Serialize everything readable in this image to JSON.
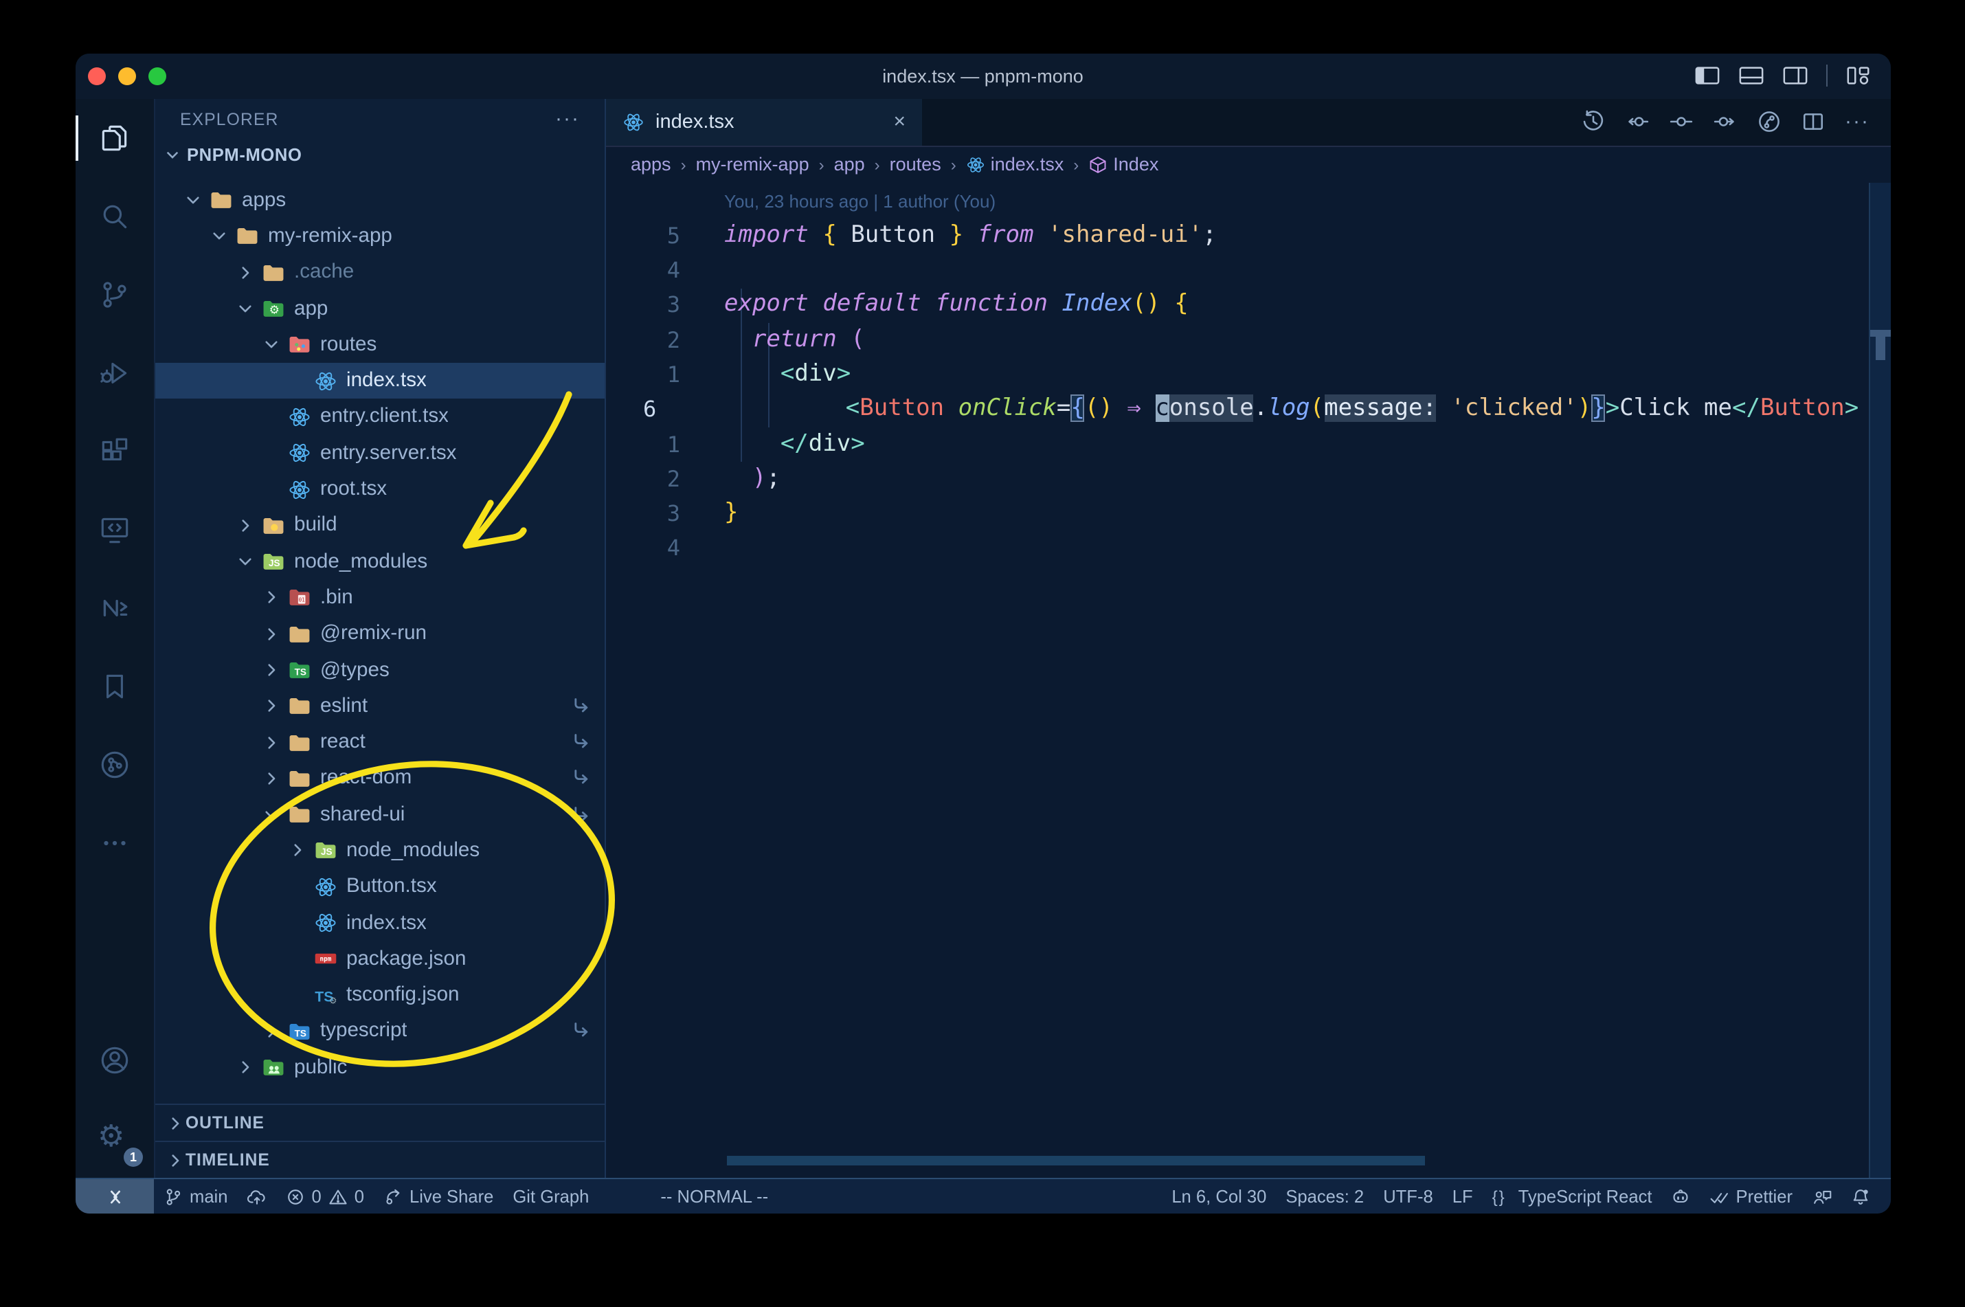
{
  "window": {
    "title": "index.tsx — pnpm-mono"
  },
  "titlebar": {
    "traffic_lights": [
      "close",
      "minimize",
      "zoom"
    ],
    "right_icons": [
      "layout-sidebar-left",
      "layout-panel",
      "layout-sidebar-right",
      "divider",
      "layout-customize"
    ]
  },
  "activity_bar": {
    "active": "files",
    "top": [
      "files",
      "search",
      "source-control",
      "run-debug",
      "extensions",
      "remote-explorer",
      "nx-console",
      "bookmarks",
      "git-graph-act",
      "more-act"
    ],
    "bottom": [
      "account",
      "settings"
    ],
    "settings_badge": "1"
  },
  "explorer": {
    "header": "EXPLORER",
    "header_more": "···",
    "root": "PNPM-MONO",
    "items": [
      {
        "label": "apps",
        "icon": "folder-tan",
        "level": 1,
        "chevron": "down"
      },
      {
        "label": "my-remix-app",
        "icon": "folder-tan",
        "level": 2,
        "chevron": "down"
      },
      {
        "label": ".cache",
        "icon": "folder-tan",
        "level": 3,
        "chevron": "right",
        "dim": true
      },
      {
        "label": "app",
        "icon": "folder-app",
        "level": 3,
        "chevron": "down"
      },
      {
        "label": "routes",
        "icon": "folder-routes",
        "level": 4,
        "chevron": "down"
      },
      {
        "label": "index.tsx",
        "icon": "react",
        "level": 5,
        "selected": true
      },
      {
        "label": "entry.client.tsx",
        "icon": "react",
        "level": 4
      },
      {
        "label": "entry.server.tsx",
        "icon": "react",
        "level": 4
      },
      {
        "label": "root.tsx",
        "icon": "react",
        "level": 4
      },
      {
        "label": "build",
        "icon": "folder-build",
        "level": 3,
        "chevron": "right"
      },
      {
        "label": "node_modules",
        "icon": "folder-js",
        "level": 3,
        "chevron": "down"
      },
      {
        "label": ".bin",
        "icon": "folder-bin",
        "level": 4,
        "chevron": "right"
      },
      {
        "label": "@remix-run",
        "icon": "folder-tan",
        "level": 4,
        "chevron": "right"
      },
      {
        "label": "@types",
        "icon": "folder-types",
        "level": 4,
        "chevron": "right"
      },
      {
        "label": "eslint",
        "icon": "folder-tan",
        "level": 4,
        "chevron": "right",
        "symlink": true
      },
      {
        "label": "react",
        "icon": "folder-tan",
        "level": 4,
        "chevron": "right",
        "symlink": true
      },
      {
        "label": "react-dom",
        "icon": "folder-tan",
        "level": 4,
        "chevron": "right",
        "symlink": true
      },
      {
        "label": "shared-ui",
        "icon": "folder-tan",
        "level": 4,
        "chevron": "down",
        "symlink": true
      },
      {
        "label": "node_modules",
        "icon": "folder-js",
        "level": 5,
        "chevron": "right"
      },
      {
        "label": "Button.tsx",
        "icon": "react",
        "level": 5
      },
      {
        "label": "index.tsx",
        "icon": "react",
        "level": 5
      },
      {
        "label": "package.json",
        "icon": "npm",
        "level": 5
      },
      {
        "label": "tsconfig.json",
        "icon": "ts-config",
        "level": 5
      },
      {
        "label": "typescript",
        "icon": "folder-ts",
        "level": 4,
        "chevron": "right",
        "symlink": true
      },
      {
        "label": "public",
        "icon": "folder-public",
        "level": 3,
        "chevron": "right"
      }
    ],
    "sections": [
      "OUTLINE",
      "TIMELINE"
    ]
  },
  "editor": {
    "tab": {
      "label": "index.tsx",
      "icon": "react",
      "close": "×"
    },
    "actions": [
      "history",
      "prev-change",
      "compare-change",
      "next-change",
      "git-graph-ed",
      "split-editor",
      "more-ed"
    ],
    "breadcrumbs": [
      {
        "label": "apps"
      },
      {
        "label": "my-remix-app"
      },
      {
        "label": "app"
      },
      {
        "label": "routes"
      },
      {
        "label": "index.tsx",
        "icon": "react"
      },
      {
        "label": "Index",
        "icon": "symbol-module"
      }
    ],
    "blame": "You, 23 hours ago | 1 author (You)",
    "code": {
      "lines": [
        {
          "gutter": "5",
          "indent": 0,
          "tokens": [
            {
              "t": "import",
              "c": "kw"
            },
            {
              "t": " ",
              "c": "pl"
            },
            {
              "t": "{",
              "c": "by"
            },
            {
              "t": " Button ",
              "c": "id"
            },
            {
              "t": "}",
              "c": "by"
            },
            {
              "t": " ",
              "c": "pl"
            },
            {
              "t": "from",
              "c": "kw"
            },
            {
              "t": " ",
              "c": "pl"
            },
            {
              "t": "'shared-ui'",
              "c": "str"
            },
            {
              "t": ";",
              "c": "pl"
            }
          ]
        },
        {
          "gutter": "4",
          "indent": 0,
          "tokens": []
        },
        {
          "gutter": "3",
          "indent": 0,
          "tokens": [
            {
              "t": "export",
              "c": "kw"
            },
            {
              "t": " ",
              "c": "pl"
            },
            {
              "t": "default",
              "c": "kw"
            },
            {
              "t": " ",
              "c": "pl"
            },
            {
              "t": "function",
              "c": "kw"
            },
            {
              "t": " ",
              "c": "pl"
            },
            {
              "t": "Index",
              "c": "fnname"
            },
            {
              "t": "()",
              "c": "by"
            },
            {
              "t": " ",
              "c": "pl"
            },
            {
              "t": "{",
              "c": "by"
            }
          ]
        },
        {
          "gutter": "2",
          "indent": 2,
          "tokens": [
            {
              "t": "return",
              "c": "kw"
            },
            {
              "t": " (",
              "c": "bp"
            }
          ]
        },
        {
          "gutter": "1",
          "indent": 4,
          "tokens": [
            {
              "t": "<",
              "c": "tb"
            },
            {
              "t": "div",
              "c": "tag"
            },
            {
              "t": ">",
              "c": "tb"
            }
          ]
        },
        {
          "gutter": "6",
          "indent": 6,
          "current": true,
          "tokens": [
            {
              "t": "<",
              "c": "tb"
            },
            {
              "t": "Button",
              "c": "comp"
            },
            {
              "t": " ",
              "c": "pl"
            },
            {
              "t": "onClick",
              "c": "attr"
            },
            {
              "t": "=",
              "c": "op"
            },
            {
              "t": "{",
              "c": "bbox"
            },
            {
              "t": "()",
              "c": "by"
            },
            {
              "t": " ",
              "c": "pl"
            },
            {
              "t": "⇒",
              "c": "arrow"
            },
            {
              "t": " ",
              "c": "pl"
            },
            {
              "t": "c",
              "c": "cursor"
            },
            {
              "t": "onsole",
              "c": "whl"
            },
            {
              "t": ".",
              "c": "pl"
            },
            {
              "t": "log",
              "c": "fn"
            },
            {
              "t": "(",
              "c": "by"
            },
            {
              "t": "message:",
              "c": "inlay"
            },
            {
              "t": " ",
              "c": "pl"
            },
            {
              "t": "'clicked'",
              "c": "str"
            },
            {
              "t": ")",
              "c": "by"
            },
            {
              "t": "}",
              "c": "bbox"
            },
            {
              "t": ">",
              "c": "tb"
            },
            {
              "t": "Click me",
              "c": "pl"
            },
            {
              "t": "</",
              "c": "tb"
            },
            {
              "t": "Button",
              "c": "comp"
            },
            {
              "t": ">",
              "c": "tb"
            }
          ]
        },
        {
          "gutter": "1",
          "indent": 4,
          "tokens": [
            {
              "t": "</",
              "c": "tb"
            },
            {
              "t": "div",
              "c": "tag"
            },
            {
              "t": ">",
              "c": "tb"
            }
          ]
        },
        {
          "gutter": "2",
          "indent": 2,
          "tokens": [
            {
              "t": ")",
              "c": "bp"
            },
            {
              "t": ";",
              "c": "pl"
            }
          ]
        },
        {
          "gutter": "3",
          "indent": 0,
          "tokens": [
            {
              "t": "}",
              "c": "by"
            }
          ]
        },
        {
          "gutter": "4",
          "indent": 0,
          "tokens": []
        }
      ]
    }
  },
  "status_bar": {
    "left": [
      {
        "name": "remote-indicator",
        "cls": "remote",
        "parts": [
          {
            "icon": "remote-status"
          }
        ]
      },
      {
        "name": "git-branch",
        "parts": [
          {
            "icon": "git-branch"
          },
          {
            "text": "main"
          }
        ]
      },
      {
        "name": "sync-changes",
        "parts": [
          {
            "icon": "cloud-upload"
          }
        ]
      },
      {
        "name": "problems",
        "parts": [
          {
            "icon": "error-circle"
          },
          {
            "text": "0"
          },
          {
            "icon": "warning-triangle"
          },
          {
            "text": "0"
          }
        ]
      },
      {
        "name": "live-share",
        "parts": [
          {
            "icon": "live-share"
          },
          {
            "text": "Live Share"
          }
        ]
      },
      {
        "name": "git-graph",
        "parts": [
          {
            "text": "Git Graph"
          }
        ]
      },
      {
        "name": "vim-mode",
        "cls": "vim",
        "parts": [
          {
            "text": "-- NORMAL --"
          }
        ]
      }
    ],
    "right": [
      {
        "name": "cursor-position",
        "parts": [
          {
            "text": "Ln 6, Col 30"
          }
        ]
      },
      {
        "name": "indentation",
        "parts": [
          {
            "text": "Spaces: 2"
          }
        ]
      },
      {
        "name": "encoding",
        "parts": [
          {
            "text": "UTF-8"
          }
        ]
      },
      {
        "name": "eol",
        "parts": [
          {
            "text": "LF"
          }
        ]
      },
      {
        "name": "language-mode",
        "parts": [
          {
            "icon": "braces"
          },
          {
            "text": "TypeScript React"
          }
        ]
      },
      {
        "name": "copilot",
        "parts": [
          {
            "icon": "copilot"
          }
        ]
      },
      {
        "name": "formatter-prettier",
        "parts": [
          {
            "icon": "double-check"
          },
          {
            "text": "Prettier"
          }
        ]
      },
      {
        "name": "feedback",
        "parts": [
          {
            "icon": "feedback"
          }
        ]
      },
      {
        "name": "notifications",
        "parts": [
          {
            "icon": "bell-dot"
          }
        ]
      }
    ]
  }
}
